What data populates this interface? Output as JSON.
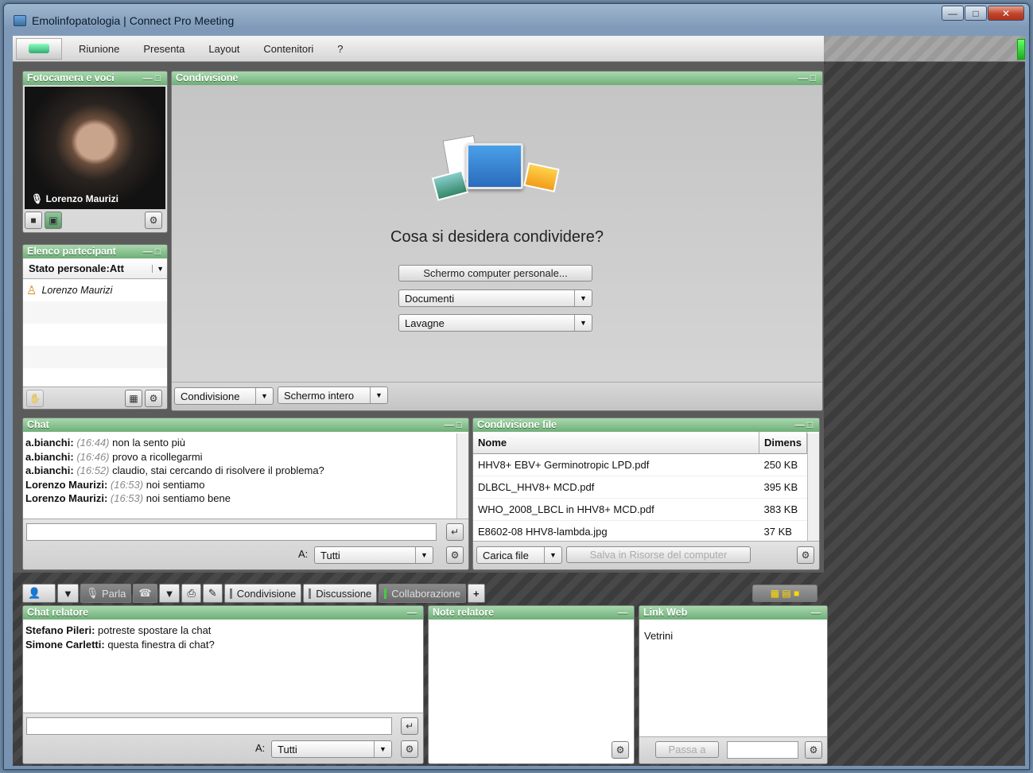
{
  "window": {
    "title": "Emolinfopatologia | Connect Pro Meeting"
  },
  "menu": {
    "items": [
      "Riunione",
      "Presenta",
      "Layout",
      "Contenitori",
      "?"
    ]
  },
  "camera_pod": {
    "title": "Fotocamera e voci",
    "name": "Lorenzo Maurizi"
  },
  "participants_pod": {
    "title": "Elenco partecipant",
    "status_label": "Stato personale:Att",
    "participants": [
      "Lorenzo Maurizi"
    ]
  },
  "share_pod": {
    "title": "Condivisione",
    "question": "Cosa si desidera condividere?",
    "screen_button": "Schermo computer personale...",
    "documents": "Documenti",
    "whiteboards": "Lavagne",
    "footer_share": "Condivisione",
    "footer_fullscreen": "Schermo intero"
  },
  "chat_pod": {
    "title": "Chat",
    "messages": [
      {
        "user": "a.bianchi:",
        "time": "(16:44)",
        "text": "non la sento più"
      },
      {
        "user": "a.bianchi:",
        "time": "(16:46)",
        "text": "provo a ricollegarmi"
      },
      {
        "user": "a.bianchi:",
        "time": "(16:52)",
        "text": "claudio, stai cercando di risolvere il problema?"
      },
      {
        "user": "Lorenzo Maurizi:",
        "time": "(16:53)",
        "text": "noi sentiamo"
      },
      {
        "user": "Lorenzo Maurizi:",
        "time": "(16:53)",
        "text": "noi sentiamo bene"
      }
    ],
    "to_label": "A:",
    "to_value": "Tutti"
  },
  "files_pod": {
    "title": "Condivisione file",
    "col_name": "Nome",
    "col_size": "Dimens",
    "files": [
      {
        "name": "HHV8+ EBV+ Germinotropic LPD.pdf",
        "size": "250 KB"
      },
      {
        "name": "DLBCL_HHV8+ MCD.pdf",
        "size": "395 KB"
      },
      {
        "name": "WHO_2008_LBCL in HHV8+ MCD.pdf",
        "size": "383 KB"
      },
      {
        "name": "E8602-08 HHV8-lambda.jpg",
        "size": "37 KB"
      }
    ],
    "upload": "Carica file",
    "save": "Salva in Risorse del computer"
  },
  "toolbar": {
    "talk": "Parla",
    "tabs": [
      "Condivisione",
      "Discussione",
      "Collaborazione"
    ],
    "add": "+"
  },
  "presenter_chat": {
    "title": "Chat relatore",
    "messages": [
      {
        "user": "Stefano Pileri:",
        "text": "potreste spostare la chat"
      },
      {
        "user": "Simone Carletti:",
        "text": "questa finestra di chat?"
      }
    ],
    "to_label": "A:",
    "to_value": "Tutti"
  },
  "presenter_notes": {
    "title": "Note relatore"
  },
  "web_links": {
    "title": "Link Web",
    "links": [
      "Vetrini"
    ],
    "go_button": "Passa a"
  }
}
